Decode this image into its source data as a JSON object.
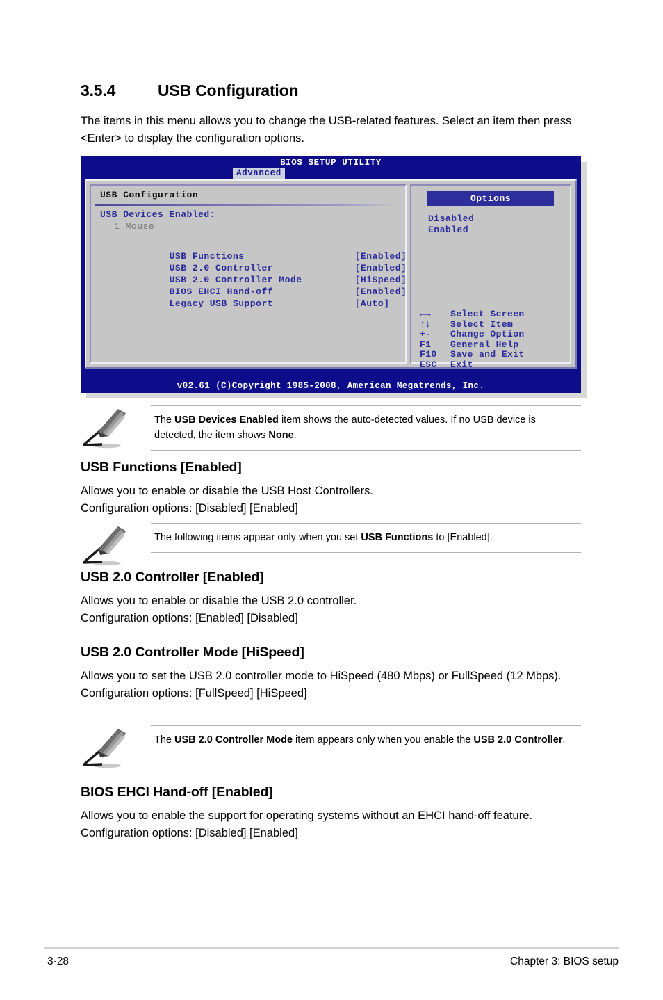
{
  "section": {
    "number": "3.5.4",
    "title": "USB Configuration",
    "intro": "The items in this menu allows you to change the USB-related features. Select an item then press <Enter> to display the configuration options."
  },
  "bios": {
    "title": "BIOS SETUP UTILITY",
    "active_tab": "Advanced",
    "config_title": "USB Configuration",
    "devices_label": "USB Devices Enabled:",
    "devices_value": "1 Mouse",
    "items": [
      {
        "name": "USB Functions",
        "value": "[Enabled]"
      },
      {
        "name": "USB 2.0 Controller",
        "value": "[Enabled]"
      },
      {
        "name": "USB 2.0 Controller Mode",
        "value": "[HiSpeed]"
      },
      {
        "name": "BIOS EHCI Hand-off",
        "value": "[Enabled]"
      },
      {
        "name": "Legacy USB Support",
        "value": "[Auto]"
      }
    ],
    "options_header": "Options",
    "options": [
      "Disabled",
      "Enabled"
    ],
    "keyhelp": [
      {
        "key": "←→",
        "label": "Select Screen"
      },
      {
        "key": "↑↓",
        "label": "Select Item"
      },
      {
        "key": "+-",
        "label": " Change Option"
      },
      {
        "key": "F1",
        "label": "General Help"
      },
      {
        "key": "F10",
        "label": "Save and Exit"
      },
      {
        "key": "ESC",
        "label": "Exit"
      }
    ],
    "footer": "v02.61 (C)Copyright 1985-2008, American Megatrends, Inc.",
    "colors": {
      "screen_blue": "#0d0d8c",
      "panel_gray": "#c6c6c6",
      "text_blue": "#2b2b9c",
      "header_blue": "#2d2d9c"
    }
  },
  "notes": {
    "note1_part1": "The ",
    "note1_bold1": "USB Devices Enabled",
    "note1_part2": " item shows the auto-detected values. If no USB device is detected, the item shows ",
    "note1_bold2": "None",
    "note1_part3": ".",
    "note2_part1": "The following items appear only when you set ",
    "note2_bold1": "USB Functions",
    "note2_part2": " to [Enabled].",
    "note3_part1": "The ",
    "note3_bold1": "USB 2.0 Controller Mode",
    "note3_part2": " item appears only when you enable the ",
    "note3_bold2": "USB 2.0 Controller",
    "note3_part3": "."
  },
  "topics": [
    {
      "heading": "USB Functions [Enabled]",
      "line1": "Allows you to enable or disable the USB Host Controllers.",
      "line2": "Configuration options: [Disabled] [Enabled]"
    },
    {
      "heading": "USB 2.0 Controller [Enabled]",
      "line1": "Allows you to enable or disable the USB 2.0 controller.",
      "line2": "Configuration options: [Enabled] [Disabled]"
    },
    {
      "heading": "USB 2.0 Controller Mode [HiSpeed]",
      "line1": "Allows you to set the USB 2.0 controller mode to HiSpeed (480 Mbps) or FullSpeed (12 Mbps).",
      "line2": "Configuration options: [FullSpeed] [HiSpeed]"
    },
    {
      "heading": "BIOS EHCI Hand-off [Enabled]",
      "line1": "Allows you to enable the support for operating systems without an EHCI hand-off feature.",
      "line2": "Configuration options: [Disabled] [Enabled]"
    }
  ],
  "footer": {
    "page": "3-28",
    "chapter": "Chapter 3: BIOS setup"
  }
}
